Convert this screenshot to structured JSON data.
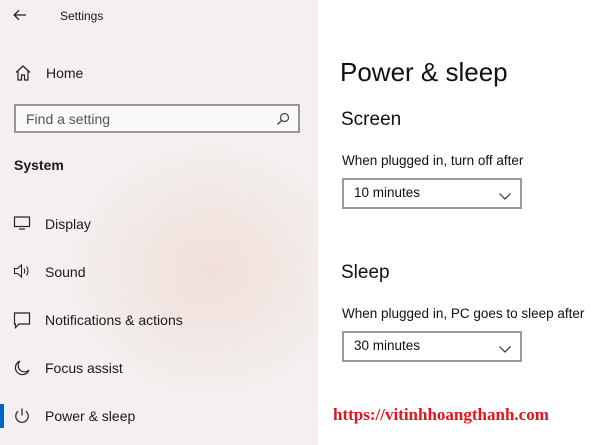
{
  "window": {
    "title": "Settings"
  },
  "sidebar": {
    "home_label": "Home",
    "search_placeholder": "Find a setting",
    "section_heading": "System",
    "items": [
      {
        "label": "Display",
        "icon": "display-icon"
      },
      {
        "label": "Sound",
        "icon": "speaker-icon"
      },
      {
        "label": "Notifications & actions",
        "icon": "notification-icon"
      },
      {
        "label": "Focus assist",
        "icon": "moon-icon"
      },
      {
        "label": "Power & sleep",
        "icon": "power-icon",
        "selected": true
      }
    ]
  },
  "main": {
    "page_title": "Power & sleep",
    "screen": {
      "heading": "Screen",
      "label": "When plugged in, turn off after",
      "value": "10 minutes"
    },
    "sleep": {
      "heading": "Sleep",
      "label": "When plugged in, PC goes to sleep after",
      "value": "30 minutes"
    }
  },
  "watermark": "https://vitinhhoangthanh.com",
  "colors": {
    "accent": "#0067c0",
    "watermark": "#e0141e"
  }
}
